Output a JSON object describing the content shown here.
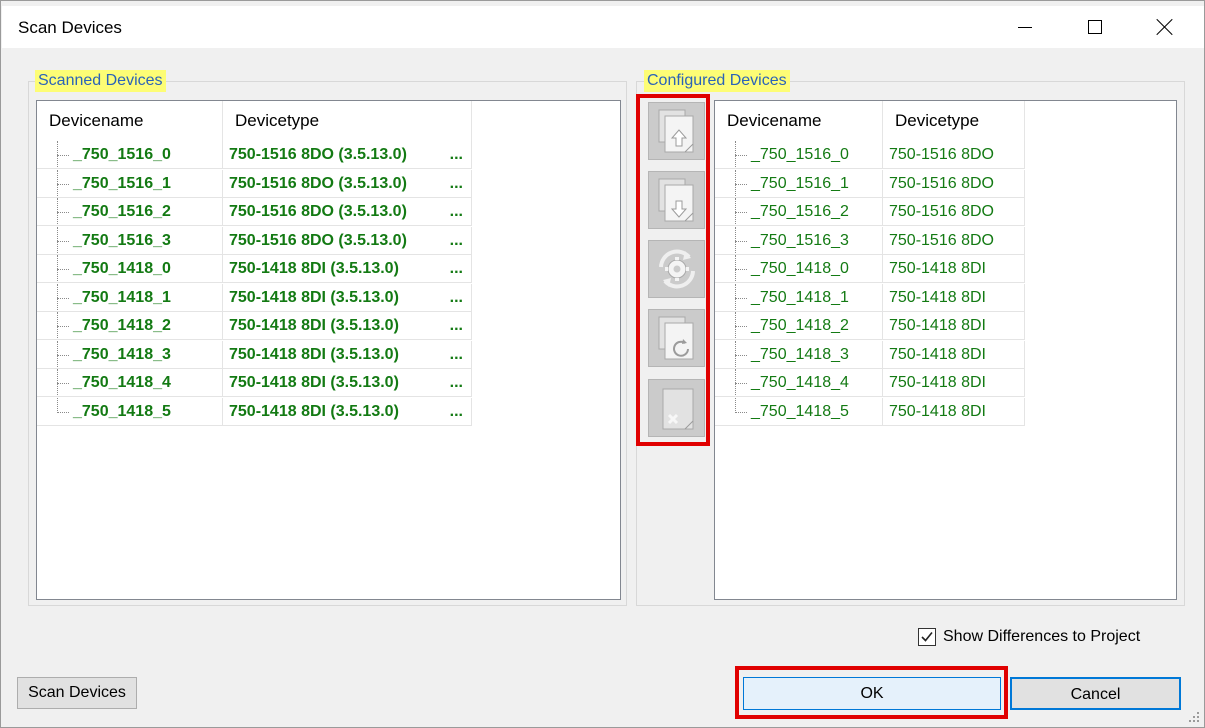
{
  "window": {
    "title": "Scan Devices"
  },
  "scanned": {
    "legend": "Scanned Devices",
    "columns": [
      "Devicename",
      "Devicetype"
    ],
    "rows": [
      {
        "name": "_750_1516_0",
        "type": "750-1516 8DO (3.5.13.0)",
        "more": "..."
      },
      {
        "name": "_750_1516_1",
        "type": "750-1516 8DO (3.5.13.0)",
        "more": "..."
      },
      {
        "name": "_750_1516_2",
        "type": "750-1516 8DO (3.5.13.0)",
        "more": "..."
      },
      {
        "name": "_750_1516_3",
        "type": "750-1516 8DO (3.5.13.0)",
        "more": "..."
      },
      {
        "name": "_750_1418_0",
        "type": "750-1418 8DI (3.5.13.0)",
        "more": "..."
      },
      {
        "name": "_750_1418_1",
        "type": "750-1418 8DI (3.5.13.0)",
        "more": "..."
      },
      {
        "name": "_750_1418_2",
        "type": "750-1418 8DI (3.5.13.0)",
        "more": "..."
      },
      {
        "name": "_750_1418_3",
        "type": "750-1418 8DI (3.5.13.0)",
        "more": "..."
      },
      {
        "name": "_750_1418_4",
        "type": "750-1418 8DI (3.5.13.0)",
        "more": "..."
      },
      {
        "name": "_750_1418_5",
        "type": "750-1418 8DI (3.5.13.0)",
        "more": "..."
      }
    ]
  },
  "configured": {
    "legend": "Configured Devices",
    "columns": [
      "Devicename",
      "Devicetype"
    ],
    "rows": [
      {
        "name": "_750_1516_0",
        "type": "750-1516 8DO"
      },
      {
        "name": "_750_1516_1",
        "type": "750-1516 8DO"
      },
      {
        "name": "_750_1516_2",
        "type": "750-1516 8DO"
      },
      {
        "name": "_750_1516_3",
        "type": "750-1516 8DO"
      },
      {
        "name": "_750_1418_0",
        "type": "750-1418 8DI"
      },
      {
        "name": "_750_1418_1",
        "type": "750-1418 8DI"
      },
      {
        "name": "_750_1418_2",
        "type": "750-1418 8DI"
      },
      {
        "name": "_750_1418_3",
        "type": "750-1418 8DI"
      },
      {
        "name": "_750_1418_4",
        "type": "750-1418 8DI"
      },
      {
        "name": "_750_1418_5",
        "type": "750-1418 8DI"
      }
    ]
  },
  "actions": [
    "copy-up-icon",
    "copy-down-icon",
    "sync-gear-icon",
    "refresh-copy-icon",
    "delete-icon"
  ],
  "show_differences": {
    "label": "Show Differences to Project",
    "checked": true
  },
  "buttons": {
    "scan": "Scan Devices",
    "ok": "OK",
    "cancel": "Cancel"
  },
  "colors": {
    "device_text": "#137a13",
    "highlight": "#fdfd75",
    "legend_text": "#2b63b8",
    "annotation_frame": "#e00000"
  }
}
